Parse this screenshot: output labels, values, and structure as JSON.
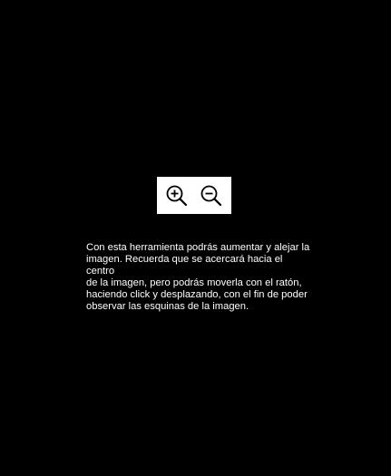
{
  "colors": {
    "background": "#000000",
    "toolbar_background": "#ffffff",
    "icon_stroke": "#000000",
    "text": "#ffffff"
  },
  "toolbar": {
    "zoom_in_icon": "zoom-in-magnifier",
    "zoom_out_icon": "zoom-out-magnifier"
  },
  "help": {
    "text": "Con esta herramienta podrás aumentar y alejar la\nimagen. Recuerda que se acercará hacia el centro\nde la imagen, pero podrás moverla con el ratón,\nhaciendo click y desplazando, con el fin de poder\nobservar las esquinas de la imagen."
  }
}
